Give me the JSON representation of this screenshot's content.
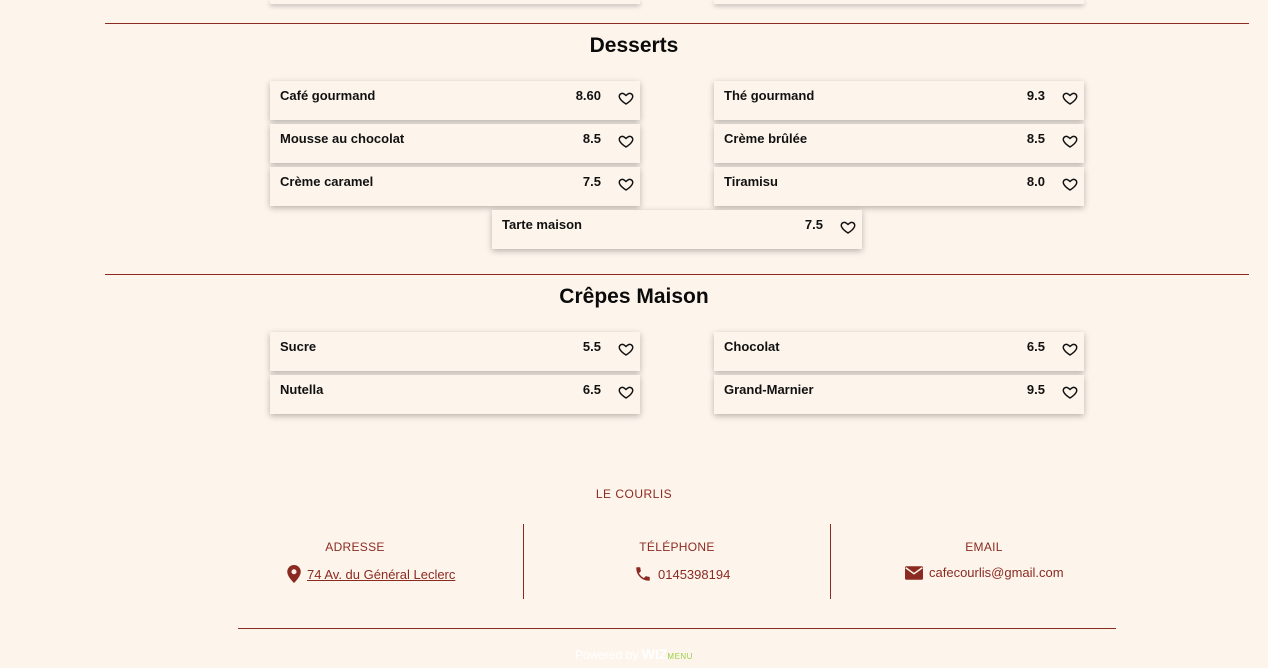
{
  "sections": [
    {
      "title": "Desserts",
      "items": [
        {
          "name": "Café gourmand",
          "price": "8.60"
        },
        {
          "name": "Thé gourmand",
          "price": "9.3"
        },
        {
          "name": "Mousse au chocolat",
          "price": "8.5"
        },
        {
          "name": "Crème brûlée",
          "price": "8.5"
        },
        {
          "name": "Crème caramel",
          "price": "7.5"
        },
        {
          "name": "Tiramisu",
          "price": "8.0"
        },
        {
          "name": "Tarte maison",
          "price": "7.5"
        }
      ]
    },
    {
      "title": "Crêpes Maison",
      "items": [
        {
          "name": "Sucre",
          "price": "5.5"
        },
        {
          "name": "Chocolat",
          "price": "6.5"
        },
        {
          "name": "Nutella",
          "price": "6.5"
        },
        {
          "name": "Grand-Marnier",
          "price": "9.5"
        }
      ]
    }
  ],
  "footer": {
    "brand": "LE COURLIS",
    "address_title": "ADRESSE",
    "address": "74 Av. du Général Leclerc",
    "phone_title": "TÉLÉPHONE",
    "phone": "0145398194",
    "email_title": "EMAIL",
    "email": "cafecourlis@gmail.com",
    "powered_by": "Powered by",
    "powered_brand": "WIZ",
    "powered_brand2": "MENU"
  },
  "colors": {
    "accent": "#8b2a21",
    "background": "#fdf5ec"
  }
}
